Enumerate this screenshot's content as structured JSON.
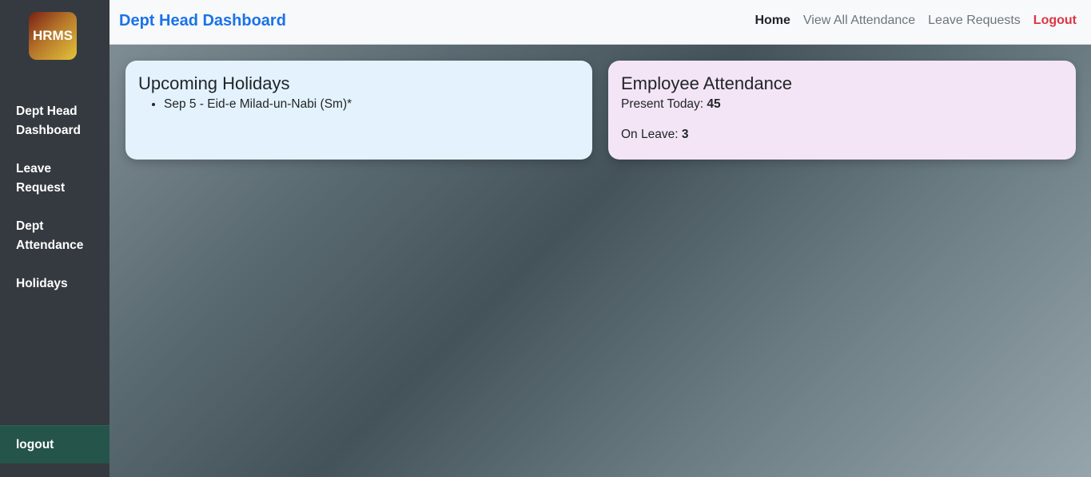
{
  "sidebar": {
    "logo_text": "HRMS",
    "items": [
      {
        "label": "Dept Head Dashboard"
      },
      {
        "label": "Leave Request"
      },
      {
        "label": "Dept Attendance"
      },
      {
        "label": "Holidays"
      }
    ],
    "logout_label": "logout"
  },
  "topbar": {
    "brand": "Dept Head Dashboard",
    "links": [
      {
        "label": "Home"
      },
      {
        "label": "View All Attendance"
      },
      {
        "label": "Leave Requests"
      },
      {
        "label": "Logout"
      }
    ]
  },
  "holidays_card": {
    "title": "Upcoming Holidays",
    "items": [
      "Sep 5 - Eid-e Milad-un-Nabi (Sm)*"
    ]
  },
  "attendance_card": {
    "title": "Employee Attendance",
    "present_label": "Present Today: ",
    "present_value": "45",
    "leave_label": "On Leave: ",
    "leave_value": "3"
  },
  "colors": {
    "sidebar_bg": "#343a40",
    "brand": "#1a73e8",
    "logout_link": "#dc3545",
    "holidays_card_bg": "#e3f2fd",
    "attendance_card_bg": "#f3e5f5"
  }
}
